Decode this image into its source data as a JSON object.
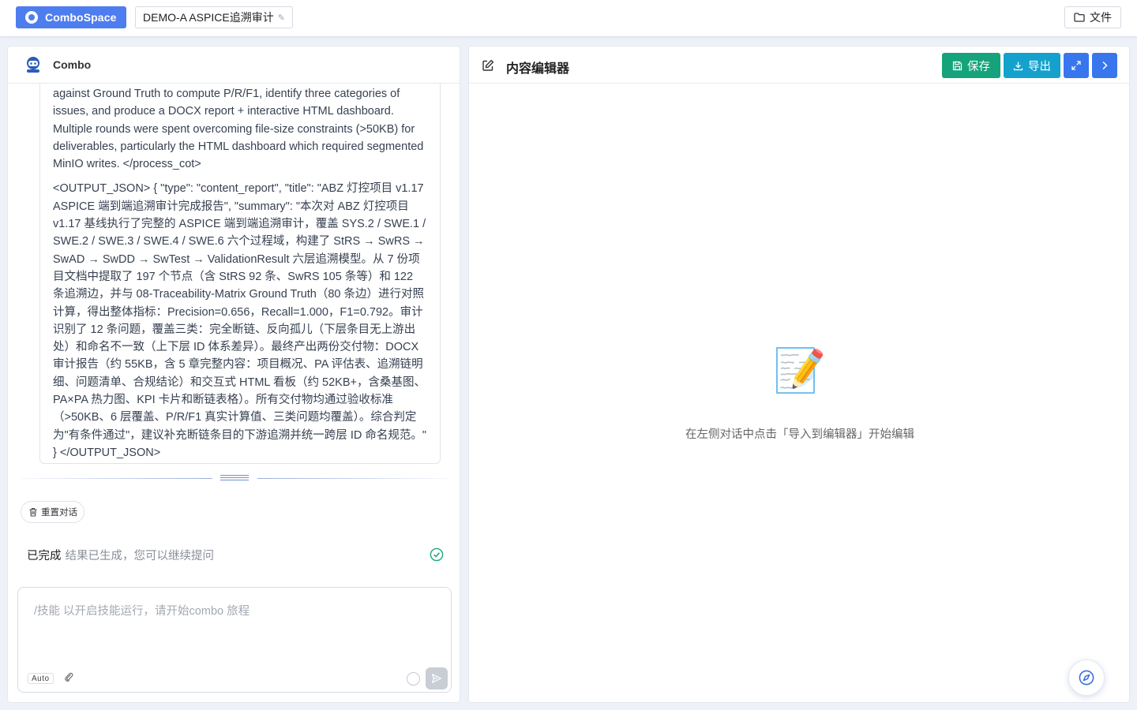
{
  "topbar": {
    "brand_label": "ComboSpace",
    "project_name": "DEMO-A ASPICE追溯审计",
    "project_edit_icon": "pencil-icon",
    "files_label": "文件",
    "files_icon": "folder-icon"
  },
  "chat": {
    "title": "Combo",
    "avatar_icon": "robot-icon",
    "message": {
      "paragraph_1": "against Ground Truth to compute P/R/F1, identify three categories of issues, and produce a DOCX report + interactive HTML dashboard. Multiple rounds were spent overcoming file-size constraints (>50KB) for deliverables, particularly the HTML dashboard which required segmented MinIO writes. </process_cot>",
      "paragraph_2": "<OUTPUT_JSON> { \"type\": \"content_report\", \"title\": \"ABZ 灯控项目 v1.17 ASPICE 端到端追溯审计完成报告\", \"summary\": \"本次对 ABZ 灯控项目 v1.17 基线执行了完整的 ASPICE 端到端追溯审计，覆盖 SYS.2 / SWE.1 / SWE.2 / SWE.3 / SWE.4 / SWE.6 六个过程域，构建了 StRS → SwRS → SwAD → SwDD → SwTest → ValidationResult 六层追溯模型。从 7 份项目文档中提取了 197 个节点（含 StRS 92 条、SwRS 105 条等）和 122 条追溯边，并与 08-Traceability-Matrix Ground Truth（80 条边）进行对照计算，得出整体指标：Precision=0.656，Recall=1.000，F1=0.792。审计识别了 12 条问题，覆盖三类：完全断链、反向孤儿（下层条目无上游出处）和命名不一致（上下层 ID 体系差异）。最终产出两份交付物：DOCX 审计报告（约 55KB，含 5 章完整内容：项目概况、PA 评估表、追溯链明细、问题清单、合规结论）和交互式 HTML 看板（约 52KB+，含桑基图、PA×PA 热力图、KPI 卡片和断链表格）。所有交付物均通过验收标准（>50KB、6 层覆盖、P/R/F1 真实计算值、三类问题均覆盖）。综合判定为\"有条件通过\"，建议补充断链条目的下游追溯并统一跨层 ID 命名规范。\" } </OUTPUT_JSON>"
    },
    "reset_label": "重置对话",
    "status_done": "已完成",
    "status_sub": "结果已生成，您可以继续提问",
    "input_placeholder": "/技能 以开启技能运行，请开始combo 旅程",
    "auto_label": "Auto"
  },
  "editor": {
    "title": "内容编辑器",
    "save_label": "保存",
    "export_label": "导出",
    "empty_emoji": "📝",
    "empty_hint": "在左侧对话中点击「导入到编辑器」开始编辑"
  },
  "colors": {
    "brand": "#4e7df0",
    "save": "#14a37a",
    "export": "#14a2cc",
    "primary": "#3876ee",
    "success": "#19a974"
  }
}
